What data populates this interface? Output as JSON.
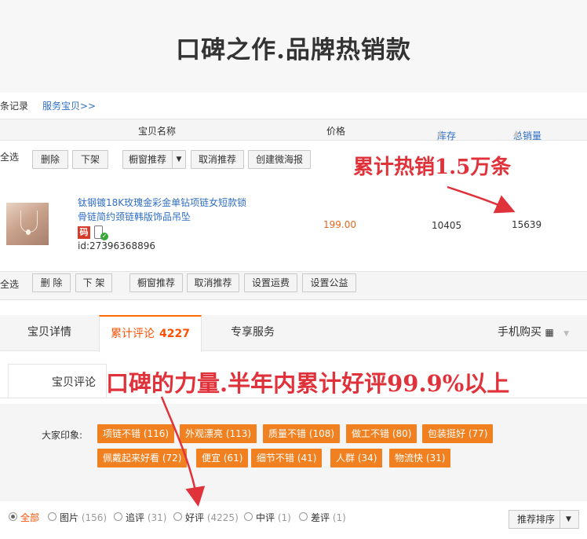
{
  "banner": {
    "title": "口碑之作.品牌热销款"
  },
  "topnav": {
    "record": "条记录",
    "service_link": "服务宝贝>>"
  },
  "table_header": {
    "name": "宝贝名称",
    "price": "价格",
    "stock": "库存",
    "sales": "总销量"
  },
  "toolbar_top": {
    "select_all": "全选",
    "delete": "删除",
    "delist": "下架",
    "recommend": "橱窗推荐",
    "cancel_recommend": "取消推荐",
    "create_poster": "创建微海报"
  },
  "product": {
    "title": "钛钢镀18K玫瑰金彩金单钻项链女短款锁骨链简约颈链韩版饰品吊坠",
    "badge": "码",
    "id": "id:27396368896",
    "price": "199.00",
    "stock": "10405",
    "sales": "15639"
  },
  "toolbar_bottom": {
    "select_all": "全选",
    "delete": "删 除",
    "delist": "下 架",
    "recommend": "橱窗推荐",
    "cancel_recommend": "取消推荐",
    "set_shipping": "设置运费",
    "set_welfare": "设置公益"
  },
  "annotations": {
    "sales_note": "累计热销1.5万条",
    "review_note": "口碑的力量.半年内累计好评99.9%以上"
  },
  "tabs": {
    "detail": "宝贝详情",
    "reviews": "累计评论",
    "reviews_count": "4227",
    "service": "专享服务",
    "mobile": "手机购买"
  },
  "subtab": {
    "label": "宝贝评论"
  },
  "impressions": {
    "label": "大家印象:",
    "tags": [
      "项链不错 (116)",
      "外观漂亮 (113)",
      "质量不错 (108)",
      "做工不错 (80)",
      "包装挺好 (77)",
      "佩戴起来好看 (72)",
      "便宜 (61)",
      "细节不错 (41)",
      "人群 (34)",
      "物流快 (31)"
    ],
    "tag_color": "#f08020"
  },
  "filters": {
    "items": [
      {
        "label": "全部",
        "count": ""
      },
      {
        "label": "图片",
        "count": "(156)"
      },
      {
        "label": "追评",
        "count": "(31)"
      },
      {
        "label": "好评",
        "count": "(4225)"
      },
      {
        "label": "中评",
        "count": "(1)"
      },
      {
        "label": "差评",
        "count": "(1)"
      }
    ],
    "sort_label": "推荐排序"
  },
  "colors": {
    "accent": "#ff5000",
    "link": "#2f6fc5",
    "annotation": "#e0323a"
  }
}
